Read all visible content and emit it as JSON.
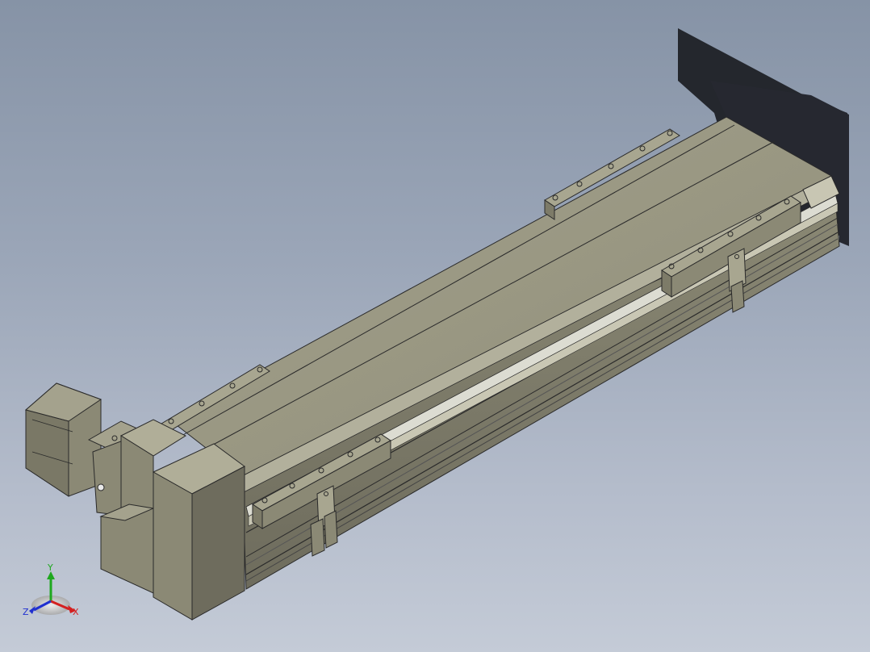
{
  "viewport": {
    "background_top": "#8693a6",
    "background_bottom": "#c4cbd7"
  },
  "model": {
    "body_color": "#9c9a84",
    "body_dark_color": "#6e6c5d",
    "edge_color": "#2a2a2a",
    "shadow_color": "#1f2126"
  },
  "triad": {
    "x_label": "X",
    "y_label": "Y",
    "z_label": "Z",
    "x_color": "#d42020",
    "y_color": "#1fa81f",
    "z_color": "#2030d0"
  }
}
